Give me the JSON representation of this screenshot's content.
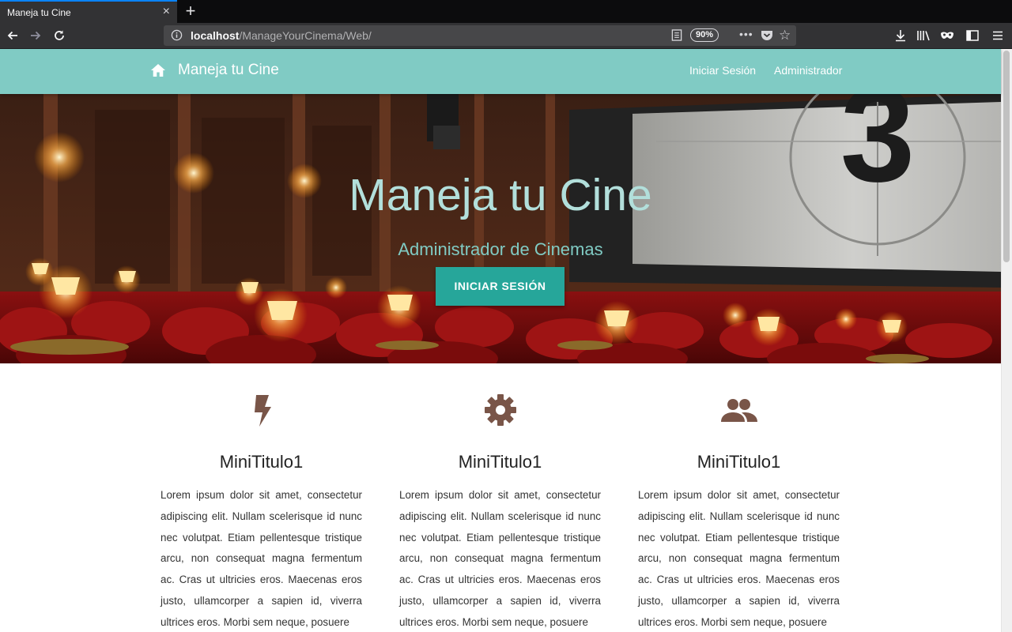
{
  "browser": {
    "tab_title": "Maneja tu Cine",
    "url_host": "localhost",
    "url_path": "/ManageYourCinema/Web/",
    "zoom": "90%",
    "close_glyph": "×",
    "newtab_glyph": "+",
    "overflow_glyph": "•••",
    "bookmark_glyph": "☆"
  },
  "site_nav": {
    "brand": "Maneja tu Cine",
    "links": [
      "Iniciar Sesión",
      "Administrador"
    ]
  },
  "hero": {
    "title": "Maneja tu Cine",
    "subtitle": "Administrador de Cinemas",
    "button": "INICIAR SESIÓN",
    "countdown_digit": "3"
  },
  "features": [
    {
      "icon": "bolt-icon",
      "title": "MiniTitulo1",
      "text": "Lorem ipsum dolor sit amet, consectetur adipiscing elit. Nullam scelerisque id nunc nec volutpat. Etiam pellentesque tristique arcu, non consequat magna fermentum ac. Cras ut ultricies eros. Maecenas eros justo, ullamcorper a sapien id, viverra ultrices eros. Morbi sem neque, posuere"
    },
    {
      "icon": "gear-icon",
      "title": "MiniTitulo1",
      "text": "Lorem ipsum dolor sit amet, consectetur adipiscing elit. Nullam scelerisque id nunc nec volutpat. Etiam pellentesque tristique arcu, non consequat magna fermentum ac. Cras ut ultricies eros. Maecenas eros justo, ullamcorper a sapien id, viverra ultrices eros. Morbi sem neque, posuere"
    },
    {
      "icon": "group-icon",
      "title": "MiniTitulo1",
      "text": "Lorem ipsum dolor sit amet, consectetur adipiscing elit. Nullam scelerisque id nunc nec volutpat. Etiam pellentesque tristique arcu, non consequat magna fermentum ac. Cras ut ultricies eros. Maecenas eros justo, ullamcorper a sapien id, viverra ultrices eros. Morbi sem neque, posuere"
    }
  ],
  "colors": {
    "nav_teal": "#80cbc4",
    "button_teal": "#26a69a",
    "hero_title": "#b2dfdb",
    "icon_brown": "#795548"
  }
}
